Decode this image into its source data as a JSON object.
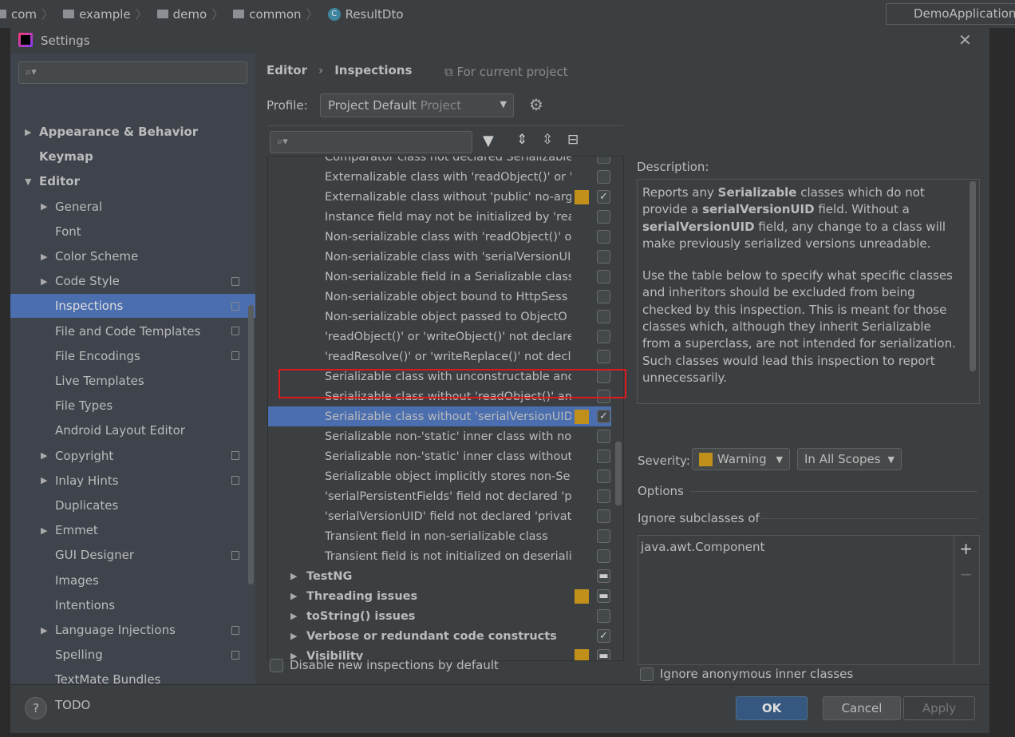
{
  "topbar": {
    "crumbs": [
      "com",
      "example",
      "demo",
      "common"
    ],
    "file": "ResultDto",
    "run_config": "DemoApplication"
  },
  "dialog": {
    "title": "Settings"
  },
  "sidebar": {
    "search_placeholder": "",
    "items": [
      {
        "label": "Appearance & Behavior",
        "bold": true,
        "arrow": "right",
        "level": 0
      },
      {
        "label": "Keymap",
        "bold": true,
        "level": 0
      },
      {
        "label": "Editor",
        "bold": true,
        "arrow": "down",
        "level": 0
      },
      {
        "label": "General",
        "arrow": "right",
        "level": 1
      },
      {
        "label": "Font",
        "level": 1
      },
      {
        "label": "Color Scheme",
        "arrow": "right",
        "level": 1
      },
      {
        "label": "Code Style",
        "arrow": "right",
        "level": 1,
        "copy": true
      },
      {
        "label": "Inspections",
        "level": 1,
        "copy": true,
        "selected": true
      },
      {
        "label": "File and Code Templates",
        "level": 1,
        "copy": true
      },
      {
        "label": "File Encodings",
        "level": 1,
        "copy": true
      },
      {
        "label": "Live Templates",
        "level": 1
      },
      {
        "label": "File Types",
        "level": 1
      },
      {
        "label": "Android Layout Editor",
        "level": 1
      },
      {
        "label": "Copyright",
        "arrow": "right",
        "level": 1,
        "copy": true
      },
      {
        "label": "Inlay Hints",
        "arrow": "right",
        "level": 1,
        "copy": true
      },
      {
        "label": "Duplicates",
        "level": 1
      },
      {
        "label": "Emmet",
        "arrow": "right",
        "level": 1
      },
      {
        "label": "GUI Designer",
        "level": 1,
        "copy": true
      },
      {
        "label": "Images",
        "level": 1
      },
      {
        "label": "Intentions",
        "level": 1
      },
      {
        "label": "Language Injections",
        "arrow": "right",
        "level": 1,
        "copy": true
      },
      {
        "label": "Spelling",
        "level": 1,
        "copy": true
      },
      {
        "label": "TextMate Bundles",
        "level": 1
      },
      {
        "label": "TODO",
        "level": 1
      }
    ]
  },
  "header": {
    "breadcrumb": [
      "Editor",
      "Inspections"
    ],
    "scope_note": "For current project"
  },
  "profile": {
    "label": "Profile:",
    "value": "Project Default",
    "sub": "Project"
  },
  "tree": {
    "rows": [
      {
        "label": "Comparator class not declared Serializable",
        "checked": false
      },
      {
        "label": "Externalizable class with 'readObject()' or 'w",
        "checked": false
      },
      {
        "label": "Externalizable class without 'public' no-arg",
        "checked": true,
        "severity": true
      },
      {
        "label": "Instance field may not be initialized by 'rea",
        "checked": false
      },
      {
        "label": "Non-serializable class with 'readObject()' o",
        "checked": false
      },
      {
        "label": "Non-serializable class with 'serialVersionUID",
        "checked": false
      },
      {
        "label": "Non-serializable field in a Serializable class",
        "checked": false
      },
      {
        "label": "Non-serializable object bound to HttpSess",
        "checked": false
      },
      {
        "label": "Non-serializable object passed to ObjectO",
        "checked": false
      },
      {
        "label": "'readObject()' or 'writeObject()' not declare",
        "checked": false
      },
      {
        "label": "'readResolve()' or 'writeReplace()' not decl",
        "checked": false
      },
      {
        "label": "Serializable class with unconstructable anc",
        "checked": false
      },
      {
        "label": "Serializable class without 'readObject()' and",
        "checked": false
      },
      {
        "label": "Serializable class without 'serialVersionUID",
        "checked": true,
        "severity": true,
        "selected": true
      },
      {
        "label": "Serializable non-'static' inner class with nor",
        "checked": false
      },
      {
        "label": "Serializable non-'static' inner class without",
        "checked": false
      },
      {
        "label": "Serializable object implicitly stores non-Se",
        "checked": false
      },
      {
        "label": "'serialPersistentFields' field not declared 'p",
        "checked": false
      },
      {
        "label": "'serialVersionUID' field not declared 'privat",
        "checked": false
      },
      {
        "label": "Transient field in non-serializable class",
        "checked": false
      },
      {
        "label": "Transient field is not initialized on deseriali",
        "checked": false
      },
      {
        "label": "TestNG",
        "group": true,
        "state": "mixed"
      },
      {
        "label": "Threading issues",
        "group": true,
        "state": "mixed",
        "severity": true
      },
      {
        "label": "toString() issues",
        "group": true,
        "state": "off"
      },
      {
        "label": "Verbose or redundant code constructs",
        "group": true,
        "state": "on"
      },
      {
        "label": "Visibility",
        "group": true,
        "state": "mixed",
        "severity": true
      }
    ]
  },
  "disable_new": "Disable new inspections by default",
  "description": {
    "label": "Description:",
    "p1": [
      [
        "Reports any ",
        false
      ],
      [
        "Serializable",
        true
      ],
      [
        " classes which do not provide a ",
        false
      ],
      [
        "serialVersionUID",
        true
      ],
      [
        " field. Without a ",
        false
      ],
      [
        "serialVersionUID",
        true
      ],
      [
        " field, any change to a class will make previously serialized versions unreadable.",
        false
      ]
    ],
    "p2": "Use the table below to specify what specific classes and inheritors should be excluded from being checked by this inspection. This is meant for those classes which, although they inherit Serializable from a superclass, are not intended for serialization. Such classes would lead this inspection to report unnecessarily."
  },
  "severity": {
    "label": "Severity:",
    "value": "Warning",
    "scope": "In All Scopes",
    "color": "#c0901a"
  },
  "options": {
    "label": "Options",
    "ignore_label": "Ignore subclasses of",
    "classes": [
      "java.awt.Component"
    ],
    "anon_label": "Ignore anonymous inner classes"
  },
  "buttons": {
    "ok": "OK",
    "cancel": "Cancel",
    "apply": "Apply",
    "help": "?"
  },
  "colors": {
    "selection": "#4b6eaf",
    "warning": "#c0901a",
    "ok": "#365880"
  }
}
